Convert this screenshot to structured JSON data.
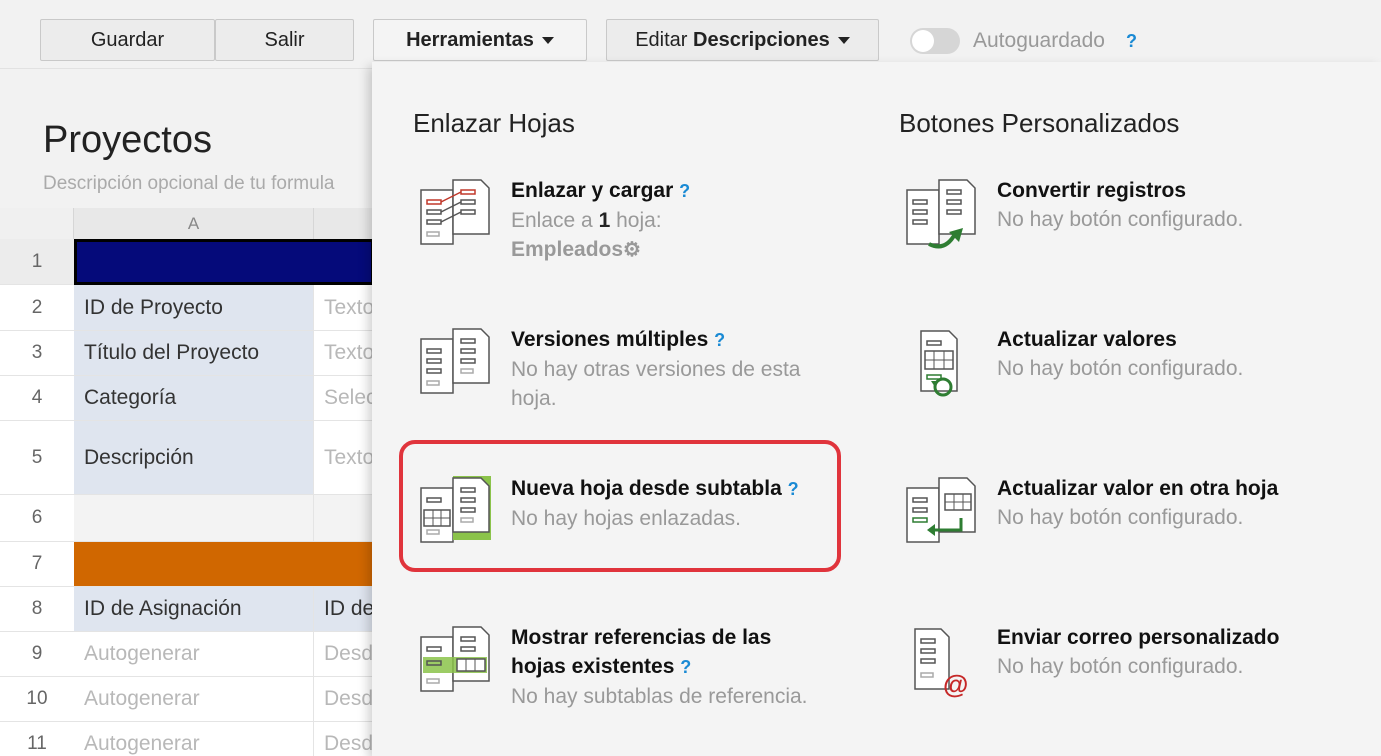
{
  "toolbar": {
    "save_label": "Guardar",
    "exit_label": "Salir",
    "tools_label": "Herramientas",
    "edit_prefix": "Editar",
    "edit_bold": "Descripciones",
    "autosave_label": "Autoguardado",
    "help_mark": "?"
  },
  "form": {
    "title": "Proyectos",
    "description_placeholder": "Descripción opcional de tu formula",
    "column_a": "A",
    "rows": [
      {
        "num": "1",
        "label": "",
        "value": ""
      },
      {
        "num": "2",
        "label": "ID de Proyecto",
        "value": "Texto"
      },
      {
        "num": "3",
        "label": "Título del Proyecto",
        "value": "Texto"
      },
      {
        "num": "4",
        "label": "Categoría",
        "value": "Selec"
      },
      {
        "num": "5",
        "label": "Descripción",
        "value": "Texto"
      },
      {
        "num": "6",
        "label": "",
        "value": ""
      },
      {
        "num": "7",
        "label": "",
        "value": ""
      },
      {
        "num": "8",
        "label": "ID de Asignación",
        "value": "ID de"
      },
      {
        "num": "9",
        "label": "Autogenerar",
        "value": "Desd"
      },
      {
        "num": "10",
        "label": "Autogenerar",
        "value": "Desd"
      },
      {
        "num": "11",
        "label": "Autogenerar",
        "value": "Desd"
      }
    ]
  },
  "panel": {
    "left_heading": "Enlazar Hojas",
    "right_heading": "Botones Personalizados",
    "left_items": [
      {
        "title": "Enlazar y cargar",
        "sub_prefix": "Enlace a ",
        "sub_bold": "1",
        "sub_suffix": " hoja:",
        "sheet": "Empleados",
        "icon": "link-load-icon"
      },
      {
        "title": "Versiones múltiples",
        "sub": "No hay otras versiones de esta hoja.",
        "icon": "multi-version-icon"
      },
      {
        "title": "Nueva hoja desde subtabla",
        "sub": "No hay hojas enlazadas.",
        "icon": "new-sheet-subtable-icon"
      },
      {
        "title_line1": "Mostrar referencias de las",
        "title_line2": "hojas existentes",
        "sub": "No hay subtablas de referencia.",
        "icon": "show-references-icon"
      }
    ],
    "right_items": [
      {
        "title": "Convertir registros",
        "sub": "No hay botón configurado.",
        "icon": "convert-records-icon"
      },
      {
        "title": "Actualizar valores",
        "sub": "No hay botón configurado.",
        "icon": "update-values-icon"
      },
      {
        "title": "Actualizar valor en otra hoja",
        "sub": "No hay botón configurado.",
        "icon": "update-other-sheet-icon"
      },
      {
        "title": "Enviar correo personalizado",
        "sub": "No hay botón configurado.",
        "icon": "send-email-icon"
      }
    ]
  },
  "colors": {
    "accent_help": "#1a8ad4",
    "highlight": "#e0343c",
    "row1": "#050a7a",
    "row7": "#d06700",
    "label_bg": "#dfe5ef"
  }
}
